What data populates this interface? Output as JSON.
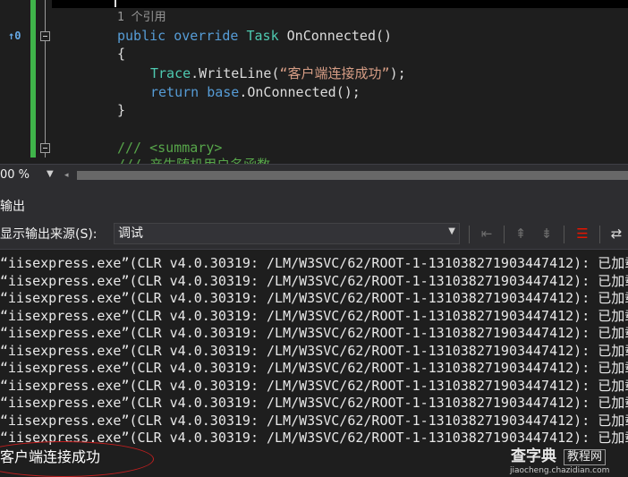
{
  "editor": {
    "gutter_indicator": "↑0",
    "codelens": "1 个引用",
    "line_signature": {
      "kw1": "public",
      "kw2": "override",
      "type": "Task",
      "method": "OnConnected()"
    },
    "open_brace": "{",
    "line_trace": {
      "class": "Trace",
      "call": ".WriteLine(",
      "string": "“客户端连接成功”",
      "end": ");"
    },
    "line_return": {
      "kw1": "return",
      "kw2": "base",
      "call": ".OnConnected();"
    },
    "close_brace": "}",
    "comment_summary": "/// <summary>",
    "comment_partial": "/// 产生随机用户名函数"
  },
  "status": {
    "zoom": "00 %"
  },
  "output_panel": {
    "title": "输出",
    "source_label": "显示输出来源(S):",
    "source_value": "调试",
    "lines": [
      "“iisexpress.exe”(CLR v4.0.30319: /LM/W3SVC/62/ROOT-1-131038271903447412): 已加载“C:\\Wi",
      "“iisexpress.exe”(CLR v4.0.30319: /LM/W3SVC/62/ROOT-1-131038271903447412): 已加载“C:\\Wi",
      "“iisexpress.exe”(CLR v4.0.30319: /LM/W3SVC/62/ROOT-1-131038271903447412): 已加载“C:\\Wi",
      "“iisexpress.exe”(CLR v4.0.30319: /LM/W3SVC/62/ROOT-1-131038271903447412): 已加载“C:\\Wi",
      "“iisexpress.exe”(CLR v4.0.30319: /LM/W3SVC/62/ROOT-1-131038271903447412): 已加载“C:\\Wi",
      "“iisexpress.exe”(CLR v4.0.30319: /LM/W3SVC/62/ROOT-1-131038271903447412): 已加载“C:\\Wi",
      "“iisexpress.exe”(CLR v4.0.30319: /LM/W3SVC/62/ROOT-1-131038271903447412): 已加载“C:\\Wi",
      "“iisexpress.exe”(CLR v4.0.30319: /LM/W3SVC/62/ROOT-1-131038271903447412): 已加载“C:\\Wi",
      "“iisexpress.exe”(CLR v4.0.30319: /LM/W3SVC/62/ROOT-1-131038271903447412): 已加载“C:\\Wi",
      "“iisexpress.exe”(CLR v4.0.30319: /LM/W3SVC/62/ROOT-1-131038271903447412): 已加载“C:\\Wi",
      "“iisexpress.exe”(CLR v4.0.30319: /LM/W3SVC/62/ROOT-1-131038271903447412): 已加载“C:\\Wi"
    ],
    "final_line": "客户端连接成功"
  },
  "watermark": {
    "main": "查字典",
    "box": "教程网",
    "url": "jiaocheng.chazidian.com"
  },
  "icons": {
    "zoom_dropdown": "chevron-down-icon",
    "source_dropdown": "chevron-down-icon",
    "toolbar": [
      "goto-previous-icon",
      "goto-next-icon",
      "goto-last-icon",
      "clear-all-icon",
      "word-wrap-icon"
    ]
  },
  "colors": {
    "keyword": "#569cd6",
    "type": "#4ec9b0",
    "string": "#d69d85",
    "comment": "#57a64a",
    "change_bar": "#3fb44a",
    "annotation": "#c21f1f"
  }
}
